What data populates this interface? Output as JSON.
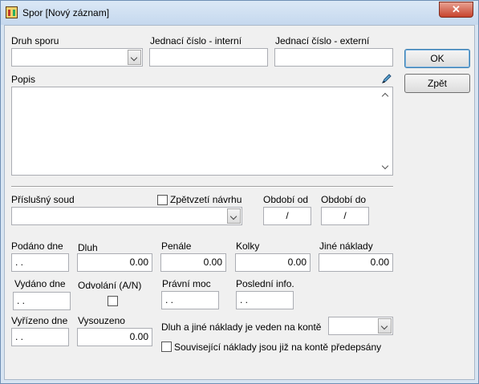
{
  "window": {
    "title": "Spor  [Nový záznam]",
    "close": "✕"
  },
  "fields": {
    "druh_sporu": {
      "label": "Druh sporu",
      "value": ""
    },
    "jednaci_interni": {
      "label": "Jednací číslo - interní",
      "value": ""
    },
    "jednaci_externi": {
      "label": "Jednací číslo - externí",
      "value": ""
    },
    "popis": {
      "label": "Popis",
      "value": ""
    },
    "soud": {
      "label": "Příslušný soud",
      "value": ""
    },
    "zpetvzeti": {
      "label": "Zpětvzetí návrhu",
      "checked": false
    },
    "obdobi_od": {
      "label": "Období od",
      "value": "/"
    },
    "obdobi_do": {
      "label": "Období do",
      "value": "/"
    },
    "podano": {
      "label": "Podáno dne",
      "value": ". ."
    },
    "dluh": {
      "label": "Dluh",
      "value": "0.00"
    },
    "penale": {
      "label": "Penále",
      "value": "0.00"
    },
    "kolky": {
      "label": "Kolky",
      "value": "0.00"
    },
    "jine_naklady": {
      "label": "Jiné náklady",
      "value": "0.00"
    },
    "vydano": {
      "label": "Vydáno dne",
      "value": ". ."
    },
    "odvolani": {
      "label": "Odvolání (A/N)",
      "checked": false
    },
    "pravni_moc": {
      "label": "Právní moc",
      "value": ". ."
    },
    "posledni_info": {
      "label": "Poslední info.",
      "value": ". ."
    },
    "vyrizeno": {
      "label": "Vyřízeno dne",
      "value": ". ."
    },
    "vysouzeno": {
      "label": "Vysouzeno",
      "value": "0.00"
    },
    "vedeno_na_konte": {
      "label": "Dluh a jiné náklady je veden na kontě",
      "value": ""
    },
    "predepsany": {
      "label": "Související náklady jsou již na kontě předepsány",
      "checked": false
    }
  },
  "buttons": {
    "ok": "OK",
    "zpet": "Zpět"
  },
  "icons": {
    "app": "app-icon",
    "edit": "pen-icon"
  }
}
